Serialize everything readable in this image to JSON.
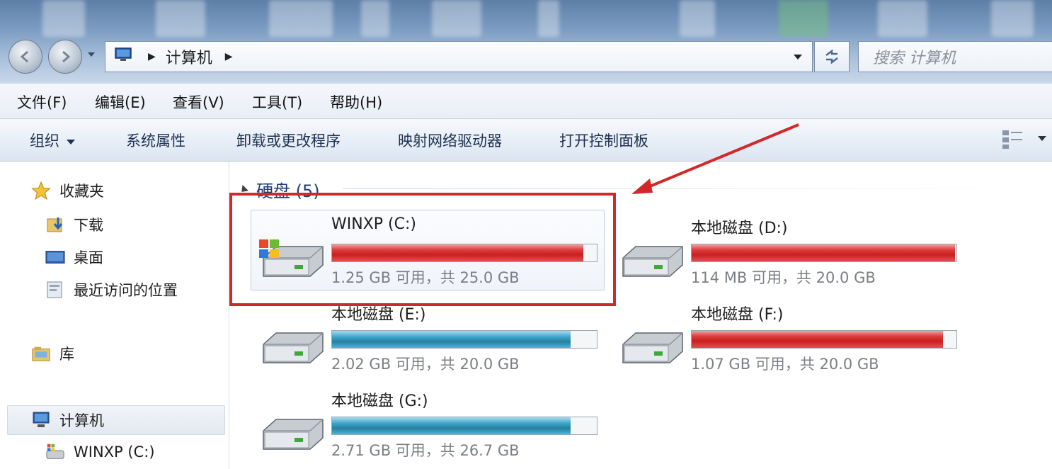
{
  "address_bar": {
    "breadcrumb": "计算机",
    "search_placeholder": "搜索 计算机"
  },
  "menu": [
    "文件(F)",
    "编辑(E)",
    "查看(V)",
    "工具(T)",
    "帮助(H)"
  ],
  "toolbar": {
    "organize": "组织",
    "system_properties": "系统属性",
    "uninstall": "卸载或更改程序",
    "map_drive": "映射网络驱动器",
    "control_panel": "打开控制面板"
  },
  "sidebar": {
    "favorites": "收藏夹",
    "downloads": "下载",
    "desktop": "桌面",
    "recent": "最近访问的位置",
    "libraries": "库",
    "computer": "计算机",
    "winxp_c": "WINXP (C:)"
  },
  "group": {
    "title": "硬盘 (5)"
  },
  "drives": [
    {
      "name": "WINXP (C:)",
      "info": "1.25 GB 可用，共 25.0 GB",
      "used_fraction": 0.95,
      "color": "red",
      "icon": "windows-drive-icon"
    },
    {
      "name": "本地磁盘 (D:)",
      "info": "114 MB 可用，共 20.0 GB",
      "used_fraction": 0.995,
      "color": "red",
      "icon": "hard-drive-icon"
    },
    {
      "name": "本地磁盘 (E:)",
      "info": "2.02 GB 可用，共 20.0 GB",
      "used_fraction": 0.9,
      "color": "blue",
      "icon": "hard-drive-icon"
    },
    {
      "name": "本地磁盘 (F:)",
      "info": "1.07 GB 可用，共 20.0 GB",
      "used_fraction": 0.95,
      "color": "red",
      "icon": "hard-drive-icon"
    },
    {
      "name": "本地磁盘 (G:)",
      "info": "2.71 GB 可用，共 26.7 GB",
      "used_fraction": 0.9,
      "color": "blue",
      "icon": "hard-drive-icon"
    }
  ],
  "colors": {
    "annotation": "#d2282a",
    "bar_red": "#c81f1f",
    "bar_blue": "#24809f",
    "link_blue": "#1e3d78"
  }
}
